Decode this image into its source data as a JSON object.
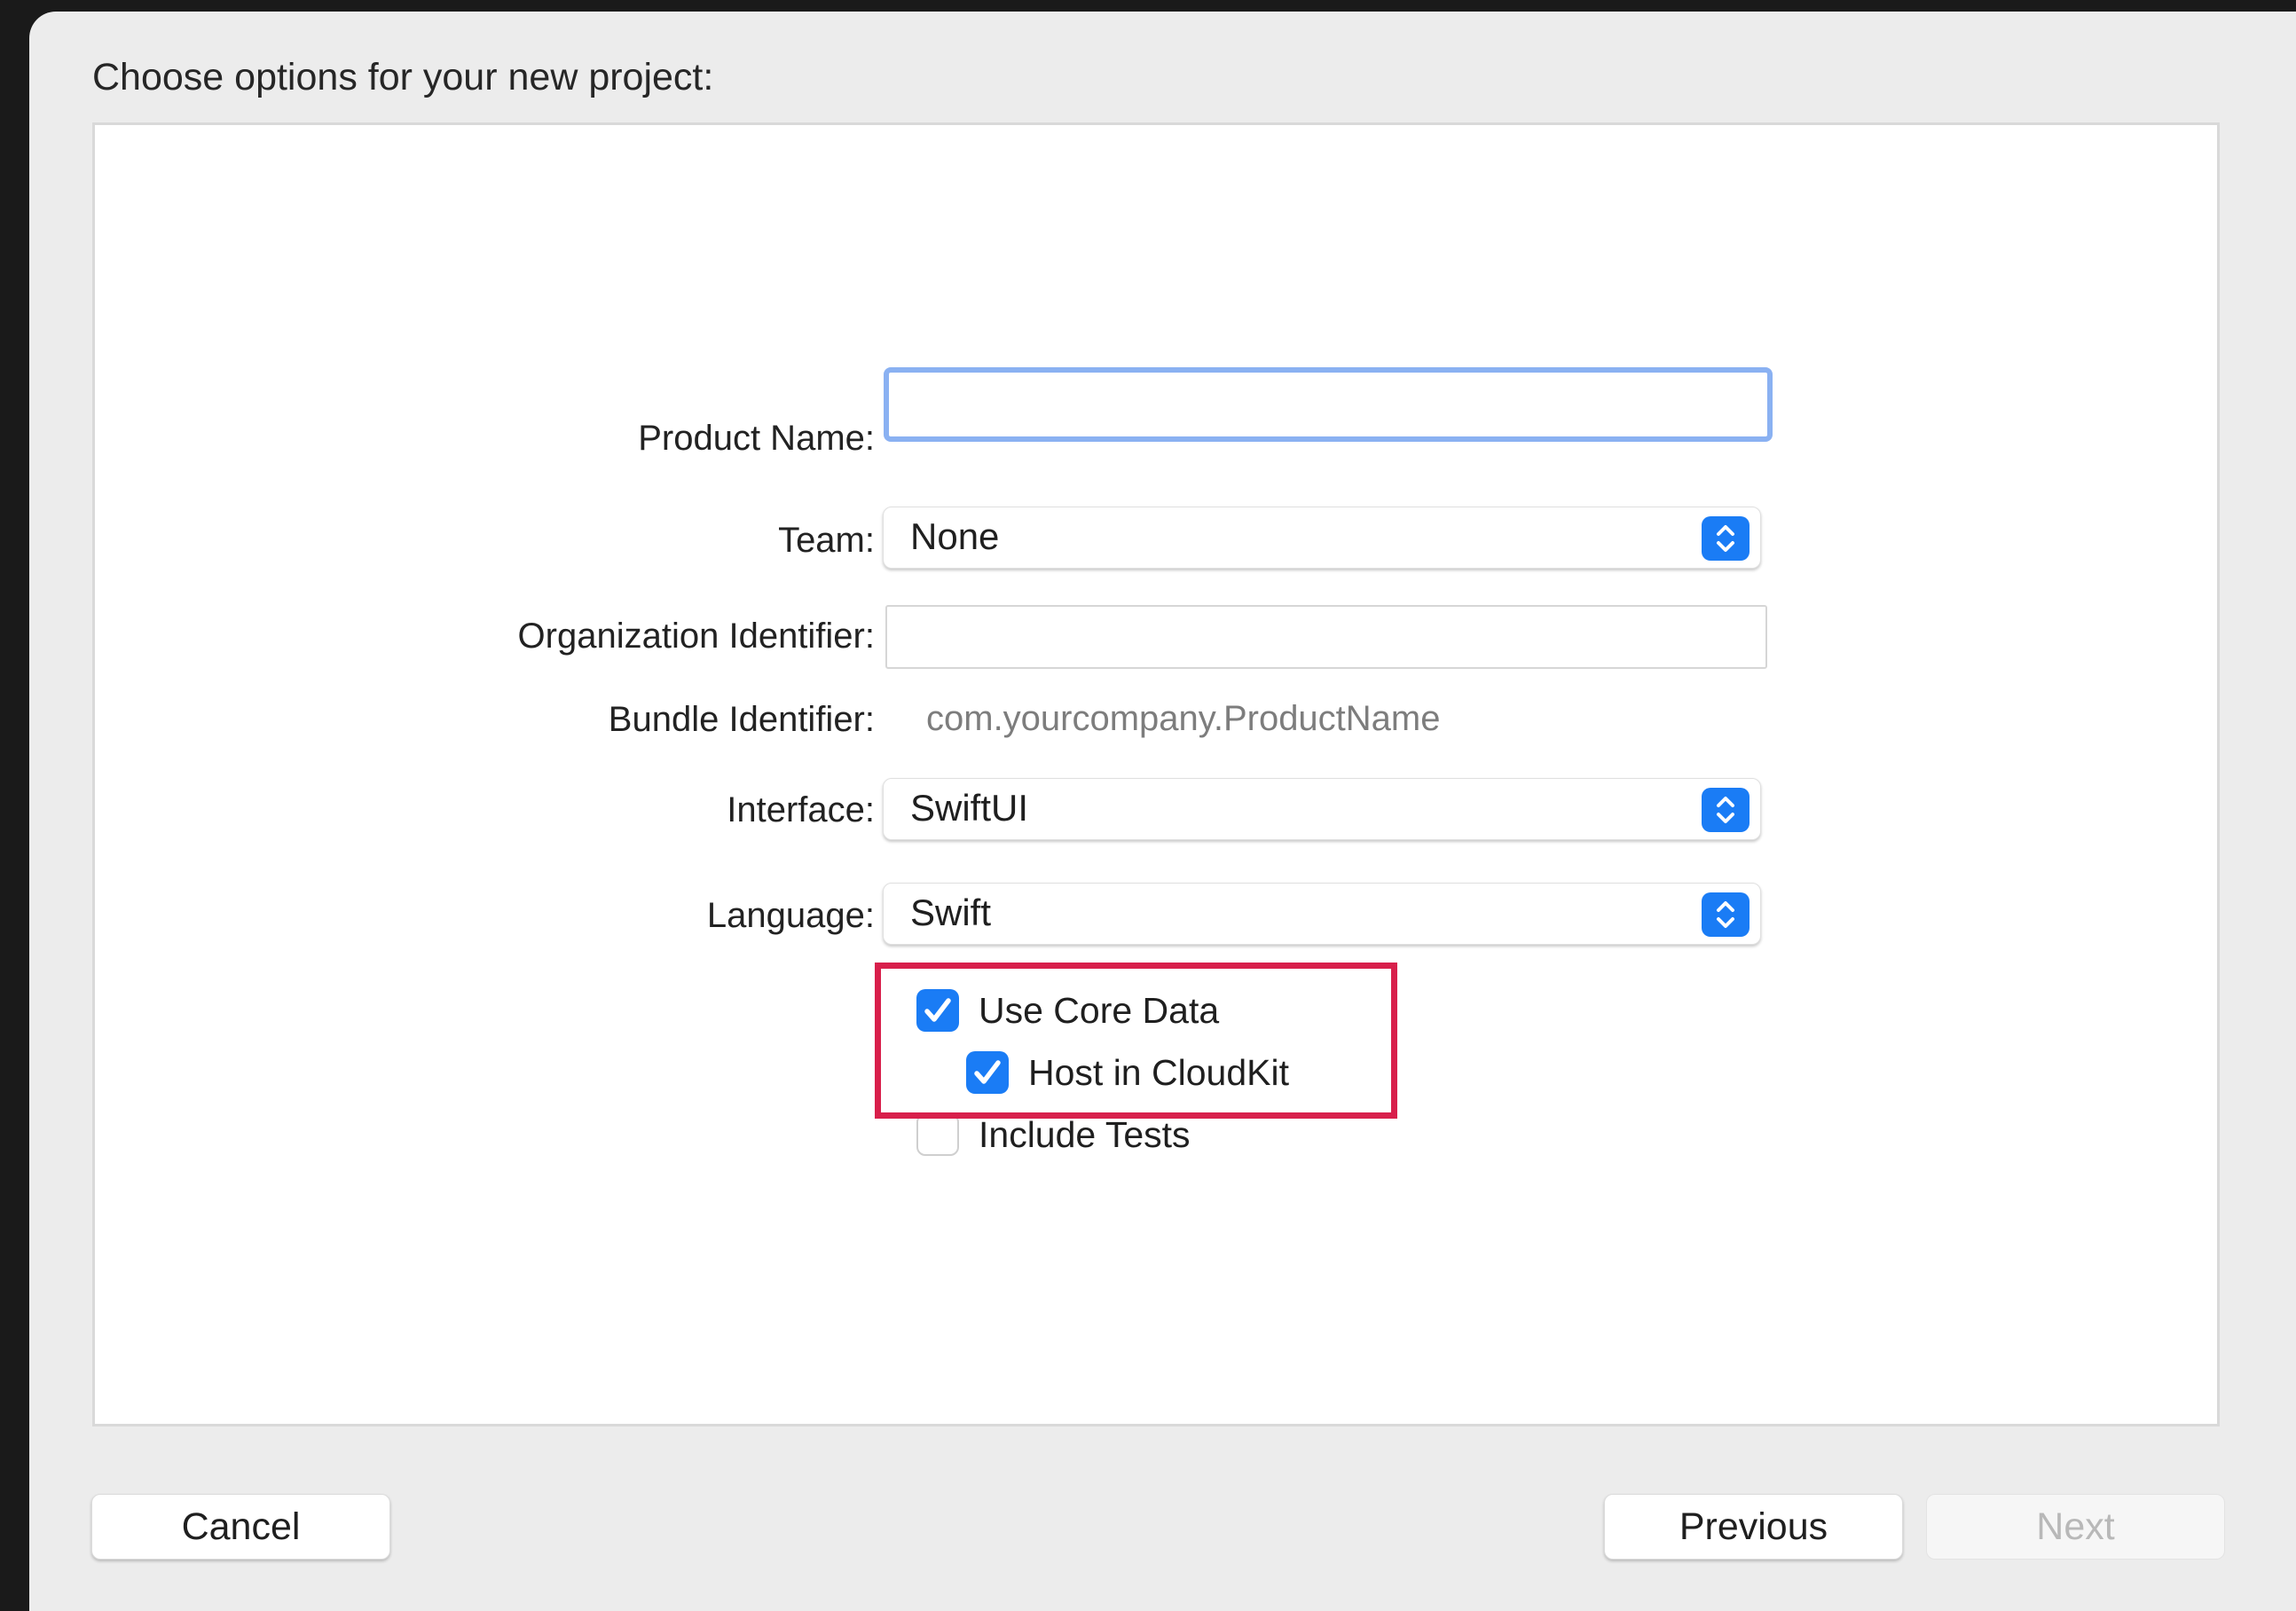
{
  "dialog": {
    "heading": "Choose options for your new project:"
  },
  "form": {
    "product_name": {
      "label": "Product Name:",
      "value": ""
    },
    "team": {
      "label": "Team:",
      "value": "None"
    },
    "organization_identifier": {
      "label": "Organization Identifier:",
      "value": ""
    },
    "bundle_identifier": {
      "label": "Bundle Identifier:",
      "value": "com.yourcompany.ProductName"
    },
    "interface": {
      "label": "Interface:",
      "value": "SwiftUI"
    },
    "language": {
      "label": "Language:",
      "value": "Swift"
    }
  },
  "options": {
    "use_core_data": {
      "label": "Use Core Data",
      "checked": true
    },
    "host_in_cloudkit": {
      "label": "Host in CloudKit",
      "checked": true
    },
    "include_tests": {
      "label": "Include Tests",
      "checked": false
    }
  },
  "buttons": {
    "cancel": "Cancel",
    "previous": "Previous",
    "next": "Next"
  },
  "colors": {
    "accent": "#1a7cf5",
    "focus_ring": "#8ab1f2",
    "highlight_box": "#d81f4b"
  }
}
